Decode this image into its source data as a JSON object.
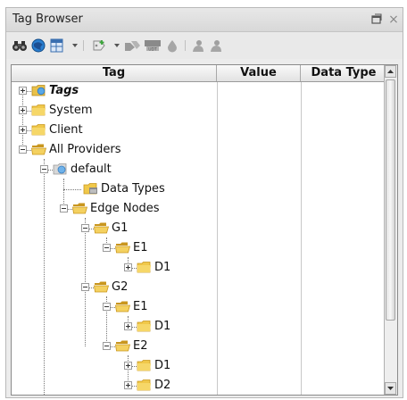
{
  "panel": {
    "title": "Tag Browser",
    "restore_icon": "restore-icon",
    "close_label": "×"
  },
  "toolbar": {
    "icons": [
      "binoculars-icon",
      "refresh-globe-icon",
      "grid-icon",
      "dropdown-arrow",
      "add-tag-icon",
      "dropdown-arrow",
      "disabled-tag-icon",
      "udt-icon",
      "disabled-drop-icon",
      "disabled-person-icon",
      "disabled-person2-icon"
    ]
  },
  "table": {
    "columns": [
      "Tag",
      "Value",
      "Data Type"
    ]
  },
  "tree": {
    "nodes": [
      {
        "label": "Tags",
        "style": "bold-italic"
      },
      {
        "label": "System"
      },
      {
        "label": "Client"
      },
      {
        "label": "All Providers"
      },
      {
        "label": "default"
      },
      {
        "label": "Data Types"
      },
      {
        "label": "Edge Nodes"
      },
      {
        "label": "G1"
      },
      {
        "label": "E1"
      },
      {
        "label": "D1"
      },
      {
        "label": "G2"
      },
      {
        "label": "E1"
      },
      {
        "label": "D1"
      },
      {
        "label": "E2"
      },
      {
        "label": "D1"
      },
      {
        "label": "D2"
      }
    ]
  },
  "colors": {
    "folder": "#f0c84a",
    "folder_dark": "#c9961e",
    "selection_panel": "#ececec"
  }
}
